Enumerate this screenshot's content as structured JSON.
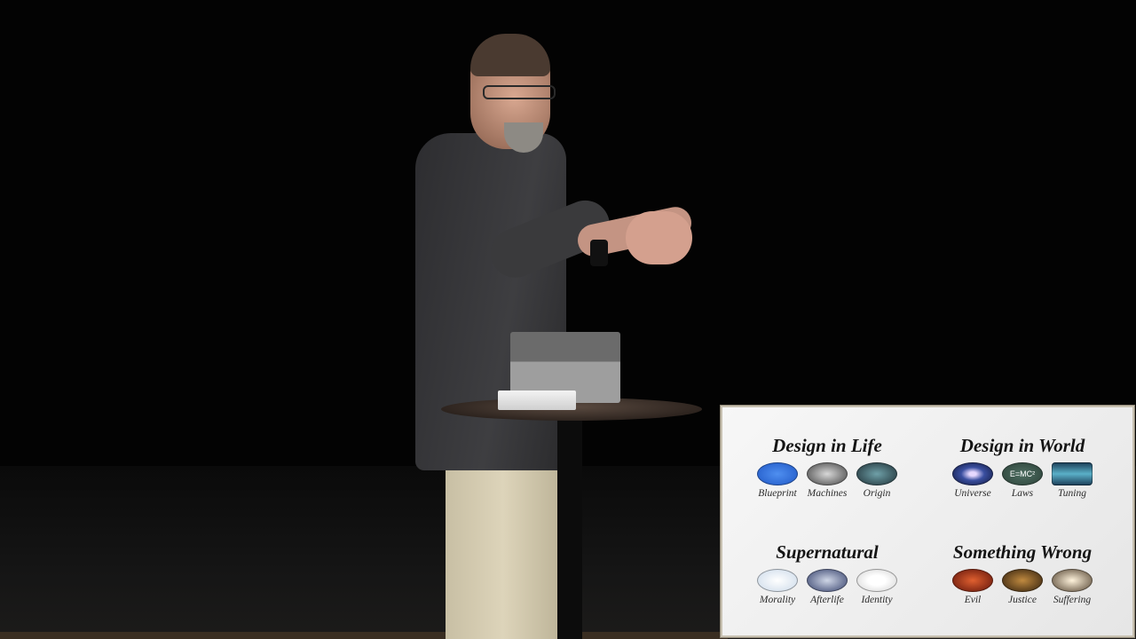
{
  "slide": {
    "quadrants": [
      {
        "title": "Design in Life",
        "items": [
          {
            "label": "Blueprint",
            "icon": "blueprint-icon"
          },
          {
            "label": "Machines",
            "icon": "machines-icon"
          },
          {
            "label": "Origin",
            "icon": "origin-icon"
          }
        ]
      },
      {
        "title": "Design in World",
        "items": [
          {
            "label": "Universe",
            "icon": "universe-icon"
          },
          {
            "label": "Laws",
            "icon": "laws-icon",
            "glyph": "E=MC²"
          },
          {
            "label": "Tuning",
            "icon": "tuning-icon"
          }
        ]
      },
      {
        "title": "Supernatural",
        "items": [
          {
            "label": "Morality",
            "icon": "morality-icon"
          },
          {
            "label": "Afterlife",
            "icon": "afterlife-icon"
          },
          {
            "label": "Identity",
            "icon": "identity-icon"
          }
        ]
      },
      {
        "title": "Something Wrong",
        "items": [
          {
            "label": "Evil",
            "icon": "evil-icon"
          },
          {
            "label": "Justice",
            "icon": "justice-icon"
          },
          {
            "label": "Suffering",
            "icon": "suffering-icon"
          }
        ]
      }
    ]
  }
}
